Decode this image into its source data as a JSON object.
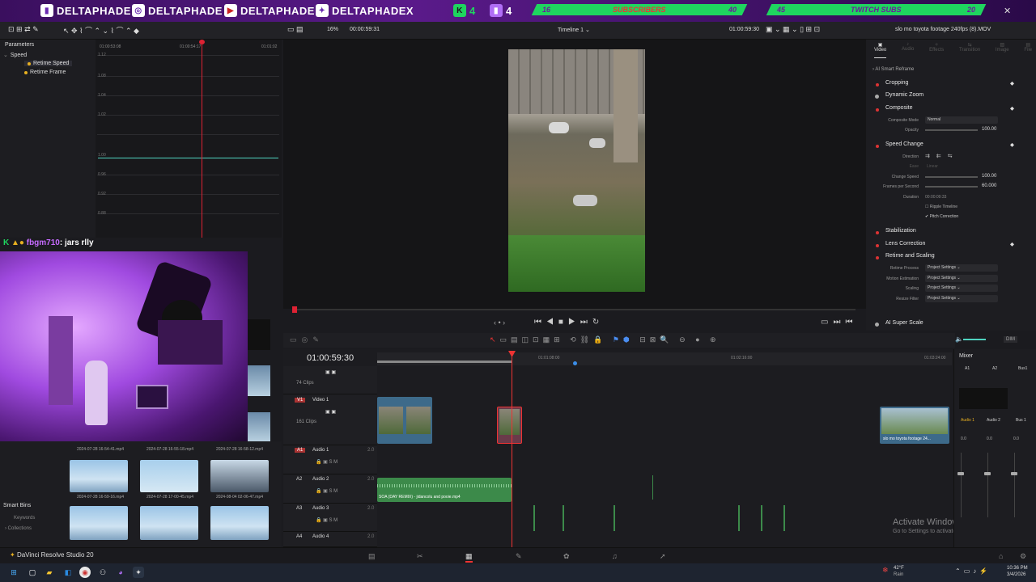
{
  "banner": {
    "handles": [
      "DELTAPHADE",
      "DELTAPHADE",
      "DELTAPHADE",
      "DELTAPHADEX"
    ],
    "kick_count": "4",
    "twitch_count": "4",
    "subs_left": "16",
    "subs_label": "SUBSCRIBERS",
    "subs_right": "40",
    "twitch_left": "45",
    "twitch_label": "TWITCH SUBS",
    "twitch_right": "20"
  },
  "toolbar": {
    "zoom": "16%",
    "timecode_left": "00:00:59:31",
    "timeline_name": "Timeline 1",
    "timecode_right": "01:00:59:30",
    "clip_name": "slo mo toyota footage 240fps (8).MOV"
  },
  "params": {
    "title": "Parameters",
    "items": [
      "Speed",
      "Retime Speed",
      "Retime Frame"
    ],
    "ruler": [
      "01:00:53:08",
      "01:00:54:17",
      "01:01:02"
    ],
    "ticks": [
      "1.12",
      "1.08",
      "1.04",
      "1.02",
      "1.00",
      "0.96",
      "0.92",
      "0.88"
    ]
  },
  "chat": {
    "user": "fbgm710",
    "message": ": jars rlly"
  },
  "inspector": {
    "tabs": [
      "Video",
      "Audio",
      "Effects",
      "Transition",
      "Image",
      "File"
    ],
    "ai_reframe": "AI Smart Reframe",
    "cropping": "Cropping",
    "dynamic_zoom": "Dynamic Zoom",
    "composite": "Composite",
    "composite_mode_label": "Composite Mode",
    "composite_mode": "Normal",
    "opacity_label": "Opacity",
    "opacity": "100.00",
    "speed_change": "Speed Change",
    "direction_label": "Direction",
    "ease_label": "Ease",
    "ease": "Linear",
    "change_speed_label": "Change Speed",
    "change_speed": "100.00",
    "fps_label": "Frames per Second",
    "fps": "60.000",
    "duration_label": "Duration",
    "duration": "00:00:09:33",
    "ripple": "Ripple Timeline",
    "pitch": "Pitch Correction",
    "stabilization": "Stabilization",
    "lens": "Lens Correction",
    "retime_scaling": "Retime and Scaling",
    "retime_process_label": "Retime Process",
    "motion_est_label": "Motion Estimation",
    "scaling_label": "Scaling",
    "resize_filter_label": "Resize Filter",
    "project_settings": "Project Settings",
    "ai_super_scale": "AI Super Scale"
  },
  "timeline": {
    "timecode": "01:00:59:30",
    "ruler": [
      "01:01:08:00",
      "01:02:16:00",
      "01:03:24:00"
    ],
    "clips74": "74 Clips",
    "video1_tag": "V1",
    "video1": "Video 1",
    "clips161": "161 Clips",
    "a1": "A1",
    "audio1": "Audio 1",
    "a2": "A2",
    "audio2": "Audio 2",
    "a3": "A3",
    "audio3": "Audio 3",
    "a4": "A4",
    "audio4": "Audio 4",
    "audio_clip": "SOA (DAY REMIX) - jidancolu and pooie.mp4",
    "end_clip": "slo mo toyota footage 24...",
    "level": "2.0"
  },
  "mixer": {
    "title": "Mixer",
    "cols": [
      "A1",
      "A2",
      "Bus1"
    ],
    "labels": [
      "Audio 1",
      "Audio 2",
      "Bus 1"
    ],
    "vals": [
      "0.0",
      "0.0",
      "0.0"
    ],
    "dim": "DIM"
  },
  "media": {
    "captions": [
      "2024-07-28 16-54-41.mp4",
      "2024-07-28 16-55-18.mp4",
      "2024-07-28 16-58-12.mp4",
      "2024-07-28 16-59-16.mp4",
      "2024-07-28 17-00-45.mp4",
      "2024-08-04 02-06-47.mp4"
    ],
    "smart_bins": "Smart Bins",
    "keywords": "Keywords",
    "collections": "Collections"
  },
  "app_name": "DaVinci Resolve Studio 20",
  "watermark": {
    "title": "Activate Windows",
    "sub": "Go to Settings to activate Windows."
  },
  "taskbar": {
    "temp": "42°F",
    "weather": "Rain",
    "time": "10:36 PM",
    "date": "3/4/2026"
  }
}
